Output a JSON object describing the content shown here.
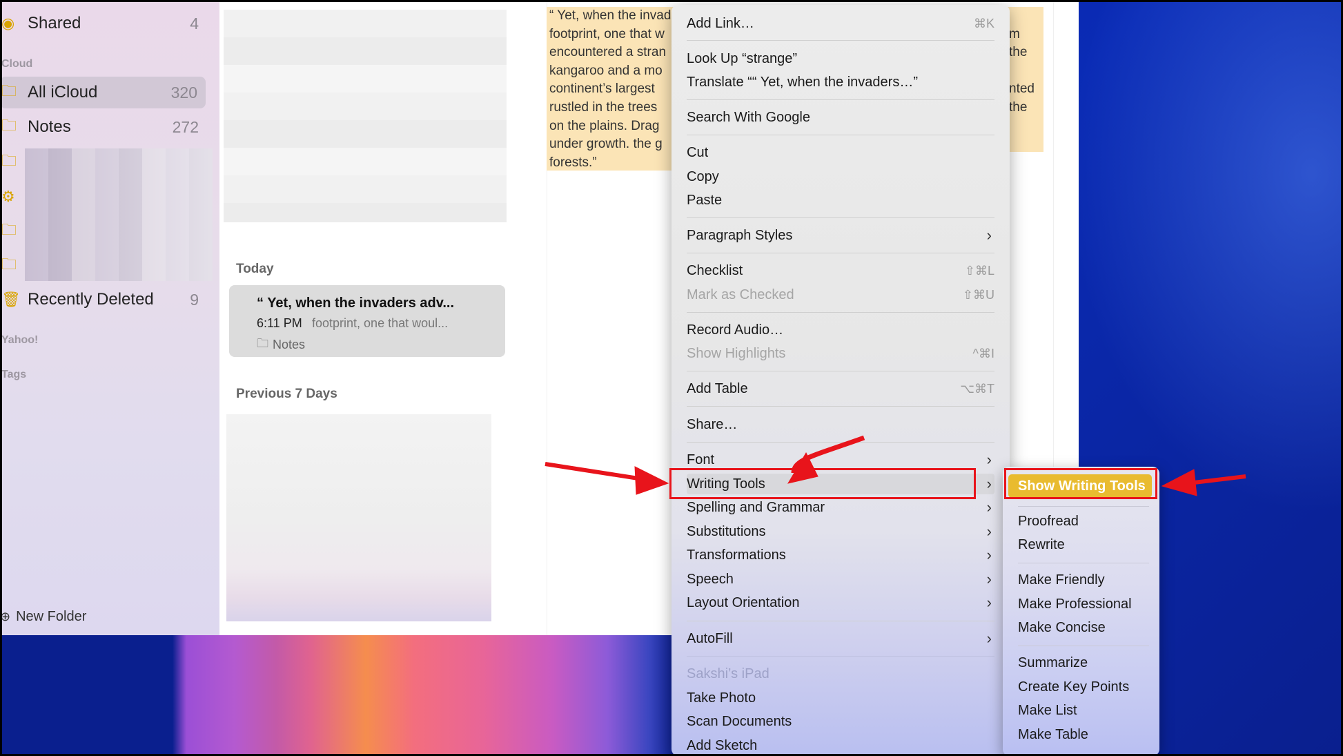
{
  "sidebar": {
    "shared": {
      "label": "Shared",
      "count": "4"
    },
    "icloud_header": "Cloud",
    "items": [
      {
        "label": "All iCloud",
        "count": "320"
      },
      {
        "label": "Notes",
        "count": "272"
      }
    ],
    "recently_deleted": {
      "label": "Recently Deleted",
      "count": "9"
    },
    "yahoo_header": "Yahoo!",
    "tags_header": "Tags",
    "new_folder": "New Folder"
  },
  "note_list": {
    "today_header": "Today",
    "previous_header": "Previous 7 Days",
    "selected_note": {
      "title": "“ Yet, when the invaders adv...",
      "time": "6:11 PM",
      "preview": "footprint, one that woul...",
      "folder": "Notes"
    }
  },
  "editor": {
    "left_lines": [
      "“ Yet, when the invad",
      "footprint, one that w",
      "encountered a stran",
      "kangaroo and a mo",
      "continent’s largest",
      "rustled in the trees",
      "on the plains. Drag",
      "under growth. the g",
      "forests.”"
    ],
    "right_lines": [
      "m",
      "the",
      "",
      "nted",
      "the"
    ]
  },
  "context_menu": {
    "add_link": {
      "label": "Add Link…",
      "shortcut": "⌘K"
    },
    "look_up": "Look Up “strange”",
    "translate": "Translate ““ Yet, when the invaders…”",
    "search_google": "Search With Google",
    "cut": "Cut",
    "copy": "Copy",
    "paste": "Paste",
    "paragraph_styles": "Paragraph Styles",
    "checklist": {
      "label": "Checklist",
      "shortcut": "⇧⌘L"
    },
    "mark_checked": {
      "label": "Mark as Checked",
      "shortcut": "⇧⌘U"
    },
    "record_audio": "Record Audio…",
    "show_highlights": {
      "label": "Show Highlights",
      "shortcut": "^⌘I"
    },
    "add_table": {
      "label": "Add Table",
      "shortcut": "⌥⌘T"
    },
    "share": "Share…",
    "font": "Font",
    "writing_tools": "Writing Tools",
    "spelling_grammar": "Spelling and Grammar",
    "substitutions": "Substitutions",
    "transformations": "Transformations",
    "speech": "Speech",
    "layout_orientation": "Layout Orientation",
    "autofill": "AutoFill",
    "device_header": "Sakshi’s iPad",
    "take_photo": "Take Photo",
    "scan_documents": "Scan Documents",
    "add_sketch": "Add Sketch"
  },
  "writing_tools_submenu": {
    "show": "Show Writing Tools",
    "proofread": "Proofread",
    "rewrite": "Rewrite",
    "make_friendly": "Make Friendly",
    "make_professional": "Make Professional",
    "make_concise": "Make Concise",
    "summarize": "Summarize",
    "create_key_points": "Create Key Points",
    "make_list": "Make List",
    "make_table": "Make Table"
  },
  "colors": {
    "annotation_red": "#e8141b",
    "highlight_yellow": "#e9bb2f",
    "text_highlight": "#fbe4b6",
    "folder_icon": "#d9a400"
  }
}
